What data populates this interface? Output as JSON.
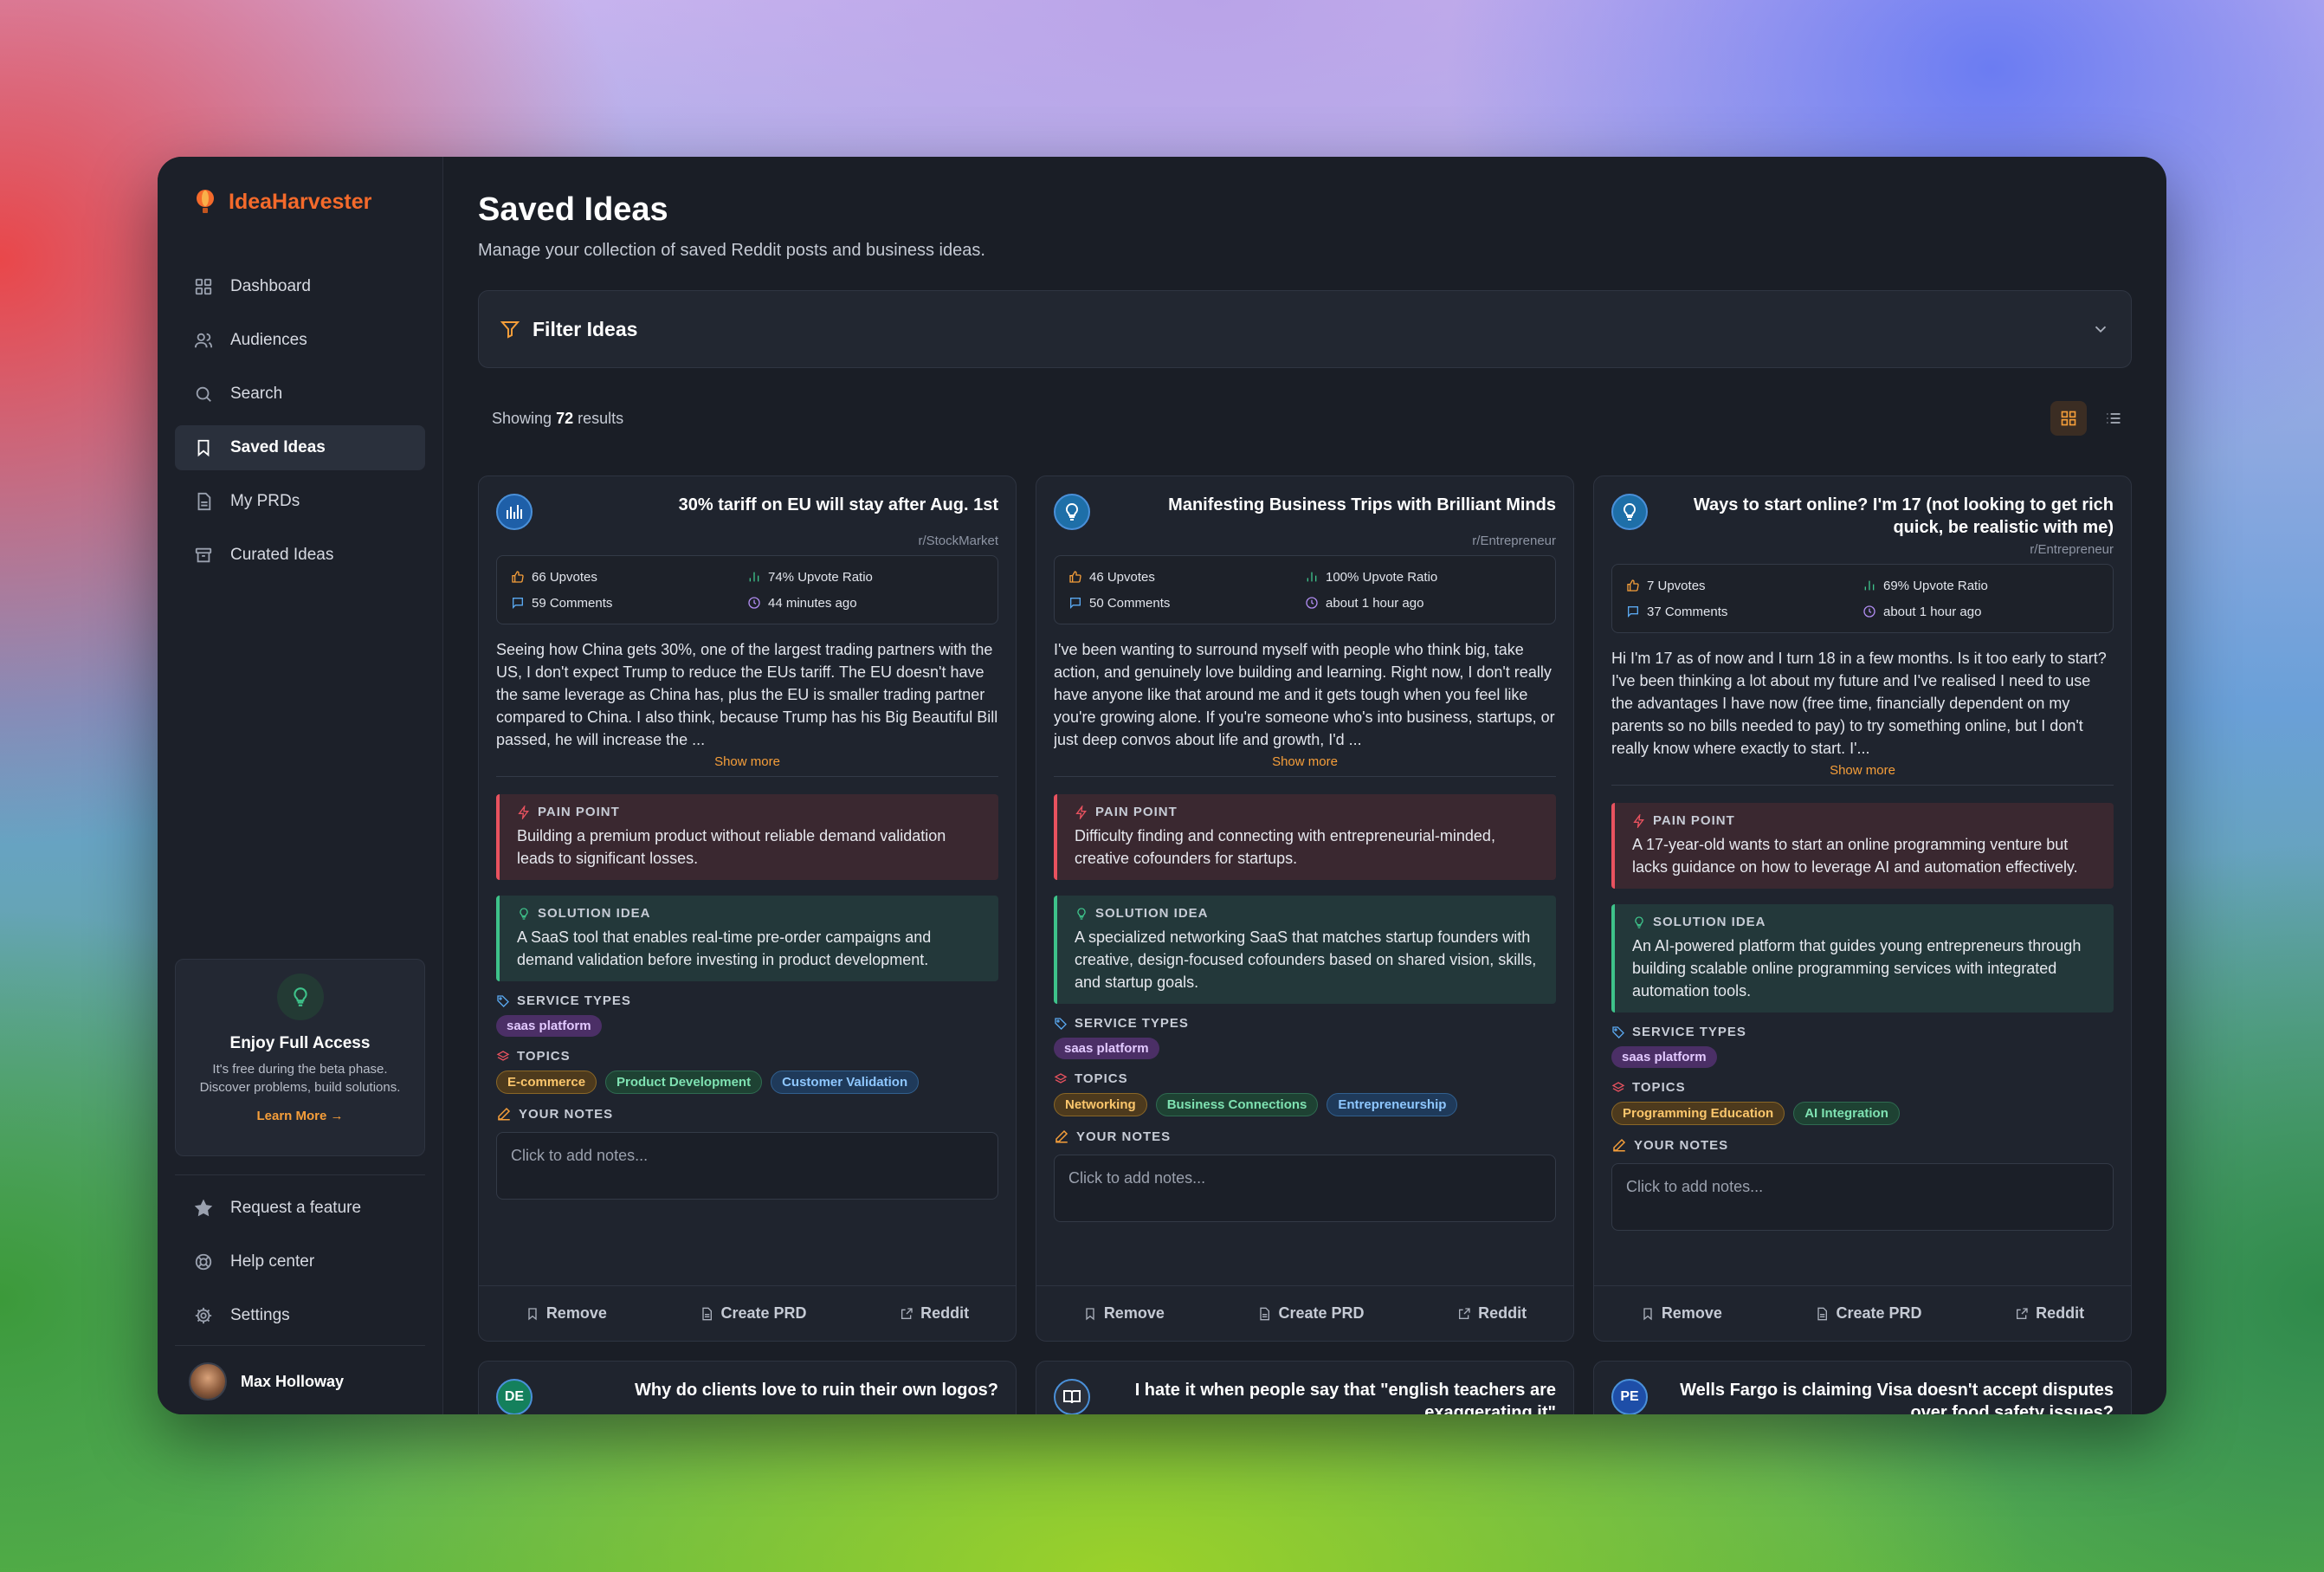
{
  "app": {
    "name": "IdeaHarvester"
  },
  "sidebar": {
    "nav": [
      {
        "label": "Dashboard",
        "icon": "grid-icon"
      },
      {
        "label": "Audiences",
        "icon": "users-icon"
      },
      {
        "label": "Search",
        "icon": "search-icon"
      },
      {
        "label": "Saved Ideas",
        "icon": "bookmark-icon",
        "active": true
      },
      {
        "label": "My PRDs",
        "icon": "document-icon"
      },
      {
        "label": "Curated Ideas",
        "icon": "archive-icon"
      }
    ],
    "promo": {
      "title": "Enjoy Full Access",
      "text": "It's free during the beta phase. Discover problems, build solutions.",
      "link": "Learn More →"
    },
    "bottom_nav": [
      {
        "label": "Request a feature",
        "icon": "star-icon"
      },
      {
        "label": "Help center",
        "icon": "lifebuoy-icon"
      },
      {
        "label": "Settings",
        "icon": "gear-icon"
      }
    ],
    "user": {
      "name": "Max Holloway"
    }
  },
  "main": {
    "title": "Saved Ideas",
    "subtitle": "Manage your collection of saved Reddit posts and business ideas.",
    "filter_label": "Filter Ideas",
    "results_prefix": "Showing",
    "results_count": "72",
    "results_suffix": "results"
  },
  "labels": {
    "pain_point": "PAIN POINT",
    "solution_idea": "SOLUTION IDEA",
    "service_types": "SERVICE TYPES",
    "topics": "TOPICS",
    "your_notes": "YOUR NOTES",
    "notes_placeholder": "Click to add notes...",
    "show_more": "Show more",
    "remove": "Remove",
    "create_prd": "Create PRD",
    "reddit": "Reddit"
  },
  "cards": [
    {
      "title": "30% tariff on EU will stay after Aug. 1st",
      "subreddit": "r/StockMarket",
      "upvotes": "66 Upvotes",
      "ratio": "74% Upvote Ratio",
      "comments": "59 Comments",
      "time": "44 minutes ago",
      "body": "Seeing how China gets 30%, one of the largest trading partners with the US, I don't expect Trump to reduce the EUs tariff. The EU doesn't have the same leverage as China has, plus the EU is smaller trading partner compared to China. I also think, because Trump has his Big Beautiful Bill passed, he will increase the ...",
      "pain": "Building a premium product without reliable demand validation leads to significant losses.",
      "solution": "A SaaS tool that enables real-time pre-order campaigns and demand validation before investing in product development.",
      "services": [
        "saas platform"
      ],
      "topics": [
        "E-commerce",
        "Product Development",
        "Customer Validation"
      ]
    },
    {
      "title": "Manifesting Business Trips with Brilliant Minds",
      "subreddit": "r/Entrepreneur",
      "upvotes": "46 Upvotes",
      "ratio": "100% Upvote Ratio",
      "comments": "50 Comments",
      "time": "about 1 hour ago",
      "body": "I've been wanting to surround myself with people who think big, take action, and genuinely love building and learning. Right now, I don't really have anyone like that around me and it gets tough when you feel like you're growing alone. If you're someone who's into business, startups, or just deep convos about life and growth, I'd ...",
      "pain": "Difficulty finding and connecting with entrepreneurial-minded, creative cofounders for startups.",
      "solution": "A specialized networking SaaS that matches startup founders with creative, design-focused cofounders based on shared vision, skills, and startup goals.",
      "services": [
        "saas platform"
      ],
      "topics": [
        "Networking",
        "Business Connections",
        "Entrepreneurship"
      ]
    },
    {
      "title": "Ways to start online? I'm 17 (not looking to get rich quick, be realistic with me)",
      "subreddit": "r/Entrepreneur",
      "upvotes": "7 Upvotes",
      "ratio": "69% Upvote Ratio",
      "comments": "37 Comments",
      "time": "about 1 hour ago",
      "body": "Hi I'm 17 as of now and I turn 18 in a few months. Is it too early to start? I've been thinking a lot about my future and I've realised I need to use the advantages I have now (free time, financially dependent on my parents so no bills needed to pay) to try something online, but I don't really know where exactly to start. I'...",
      "pain": "A 17-year-old wants to start an online programming venture but lacks guidance on how to leverage AI and automation effectively.",
      "solution": "An AI-powered platform that guides young entrepreneurs through building scalable online programming services with integrated automation tools.",
      "services": [
        "saas platform"
      ],
      "topics": [
        "Programming Education",
        "AI Integration"
      ]
    },
    {
      "title": "Why do clients love to ruin their own logos?",
      "avatar": "DE"
    },
    {
      "title": "I hate it when people say that \"english teachers are exaggerating it\""
    },
    {
      "title": "Wells Fargo is claiming Visa doesn't accept disputes over food safety issues?",
      "avatar": "PE"
    }
  ],
  "colors": {
    "brand": "#f46a2b",
    "accent": "#f59e3a",
    "pain": "#e8525f",
    "solution": "#3ec28a"
  }
}
